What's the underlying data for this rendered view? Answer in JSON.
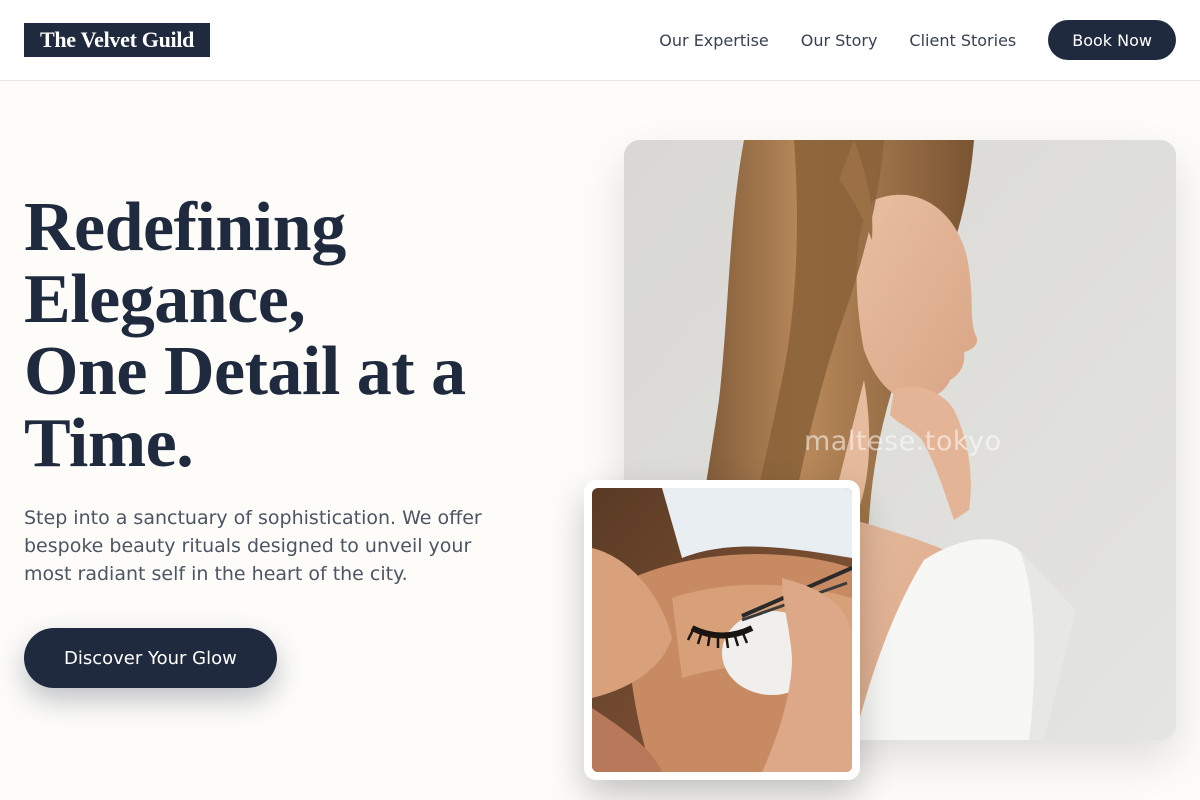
{
  "brand": {
    "logo_text": "The Velvet Guild"
  },
  "nav": {
    "links": [
      "Our Expertise",
      "Our Story",
      "Client Stories"
    ],
    "book_label": "Book Now"
  },
  "hero": {
    "headline_lines": [
      "Redefining",
      "Elegance,",
      "One Detail at a",
      "Time."
    ],
    "subtext": "Step into a sanctuary of sophistication. We offer bespoke beauty rituals designed to unveil your most radiant self in the heart of the city.",
    "cta_label": "Discover Your Glow"
  },
  "images": {
    "main_photo": "woman-profile-photo",
    "inset_photo": "eyelash-treatment-photo",
    "watermark": "maltese.tokyo"
  },
  "colors": {
    "primary": "#1f2a3f",
    "background": "#fdfcf9",
    "body_text": "#4b5563"
  }
}
